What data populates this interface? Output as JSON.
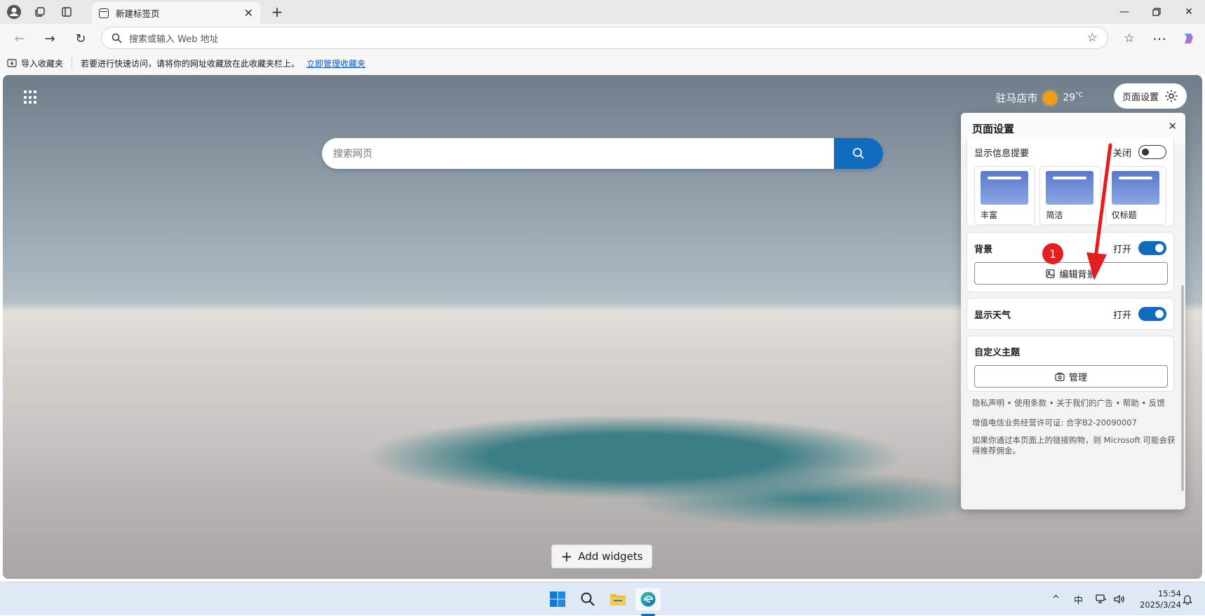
{
  "browser": {
    "tab_title": "新建标签页",
    "address_placeholder": "搜索或输入 Web 地址"
  },
  "favorites_bar": {
    "import_label": "导入收藏夹",
    "message": "若要进行快速访问，请将你的网址收藏放在此收藏夹栏上。",
    "manage_link": "立即管理收藏夹"
  },
  "newtab": {
    "city": "驻马店市",
    "temperature": "29",
    "temp_unit": "°C",
    "page_settings_label": "页面设置",
    "search_placeholder": "搜索网页",
    "add_widgets_label": "Add widgets"
  },
  "settings_panel": {
    "title": "页面设置",
    "show_info_label": "显示信息提要",
    "show_info_state": "关闭",
    "layouts": [
      {
        "label": "丰富"
      },
      {
        "label": "简洁"
      },
      {
        "label": "仅标题"
      }
    ],
    "background_label": "背景",
    "background_state": "打开",
    "edit_background_label": "编辑背景",
    "weather_label": "显示天气",
    "weather_state": "打开",
    "theme_label": "自定义主题",
    "manage_label": "管理",
    "footer_links": "隐私声明 • 使用条款 • 关于我们的广告 • 帮助 • 反馈",
    "license": "增值电信业务经营许可证: 合字B2-20090007",
    "disclaimer": "如果你通过本页面上的链接购物，则 Microsoft 可能会获得推荐佣金。"
  },
  "annotation": {
    "number": "1",
    "color": "#e41e1e"
  },
  "taskbar": {
    "ime": "中",
    "time": "15:54",
    "date": "2025/3/24"
  },
  "colors": {
    "accent": "#0f6cbd"
  }
}
